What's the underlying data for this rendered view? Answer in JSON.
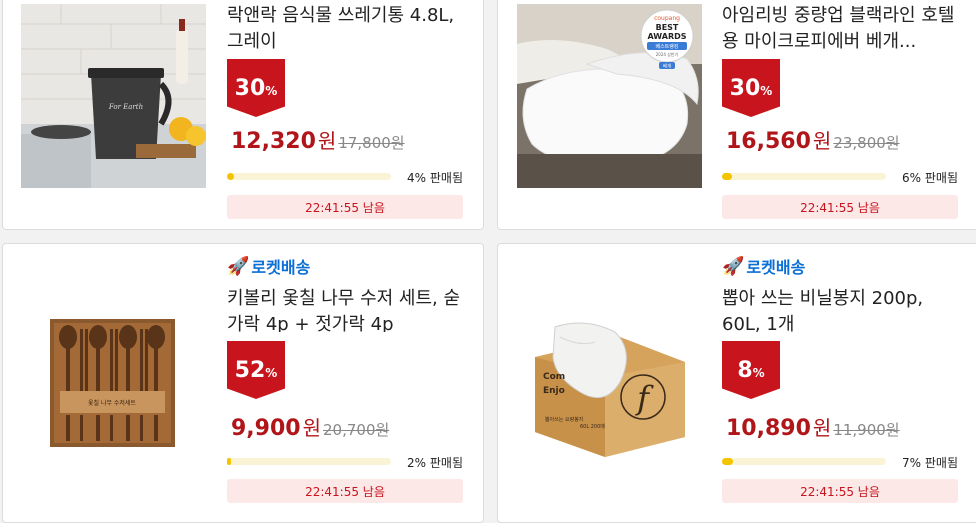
{
  "products": [
    {
      "rocket": "",
      "title": "락앤락 음식물 쓰레기통 4.8L, 그레이",
      "discount": "30",
      "discount_unit": "%",
      "price": "12,320",
      "currency": "원",
      "original_price": "17,800원",
      "sold_percent": 4,
      "sold_text": "4% 판매됨",
      "timer": "22:41:55 남음",
      "image_icon": "trash-bin-image"
    },
    {
      "rocket": "",
      "title": "아임리빙 중량업 블랙라인 호텔용 마이크로피에버 베개...",
      "discount": "30",
      "discount_unit": "%",
      "price": "16,560",
      "currency": "원",
      "original_price": "23,800원",
      "sold_percent": 6,
      "sold_text": "6% 판매됨",
      "timer": "22:41:55 남음",
      "image_icon": "pillow-image",
      "award_badge": {
        "brand": "coupang",
        "line1": "BEST",
        "line2": "AWARDS",
        "line3": "베스트랭킹",
        "line4": "2024 상반기",
        "line5": "베개"
      }
    },
    {
      "rocket": "로켓배송",
      "title": "키볼리 옻칠 나무 수저 세트, 숟가락 4p + 젓가락 4p",
      "discount": "52",
      "discount_unit": "%",
      "price": "9,900",
      "currency": "원",
      "original_price": "20,700원",
      "sold_percent": 2,
      "sold_text": "2% 판매됨",
      "timer": "22:41:55 남음",
      "image_icon": "spoon-set-image",
      "box_label": "옻칠 나무 수저세트"
    },
    {
      "rocket": "로켓배송",
      "title": "뽑아 쓰는 비닐봉지 200p, 60L, 1개",
      "discount": "8",
      "discount_unit": "%",
      "price": "10,890",
      "currency": "원",
      "original_price": "11,900원",
      "sold_percent": 7,
      "sold_text": "7% 판매됨",
      "timer": "22:41:55 남음",
      "image_icon": "plastic-bag-box-image",
      "box_text1": "Com",
      "box_text2": "Enjo",
      "box_text3": "뽑아쓰는 요량봉지",
      "box_text4": "60L 200매",
      "box_logo": "f"
    }
  ]
}
